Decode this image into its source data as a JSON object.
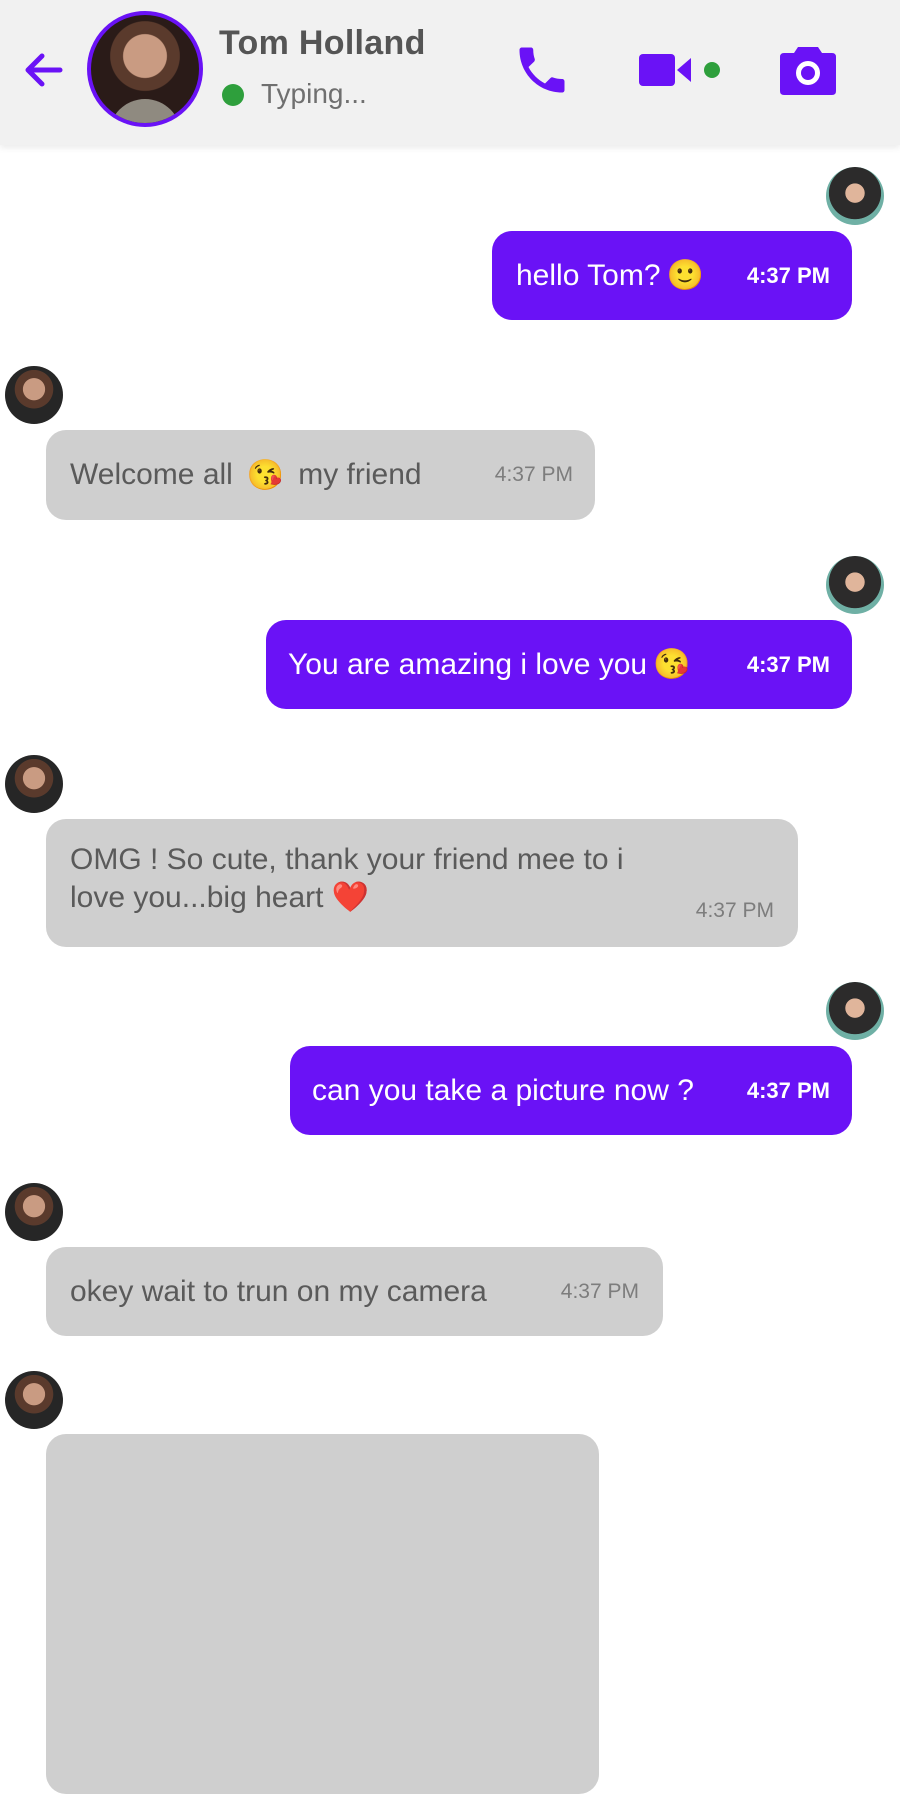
{
  "header": {
    "contact_name": "Tom Holland",
    "status": "Typing...",
    "accent_color": "#6a12f6",
    "status_color": "#2e9f3c",
    "icons": [
      "back-arrow-icon",
      "phone-icon",
      "video-icon",
      "camera-icon"
    ]
  },
  "messages": [
    {
      "sender": "me",
      "text": "hello Tom?",
      "emoji": "🙂",
      "time": "4:37 PM"
    },
    {
      "sender": "Tom Holland",
      "text_before": "Welcome all",
      "emoji": "😘",
      "text_after": "my friend",
      "time": "4:37 PM"
    },
    {
      "sender": "me",
      "text": "You are amazing i love you",
      "emoji": "😘",
      "time": "4:37 PM"
    },
    {
      "sender": "Tom Holland",
      "line1": "OMG ! So cute, thank your friend mee to i",
      "line2": "love you...big heart",
      "emoji": "❤️",
      "time": "4:37 PM"
    },
    {
      "sender": "me",
      "text": "can you take a picture now ?",
      "time": "4:37 PM"
    },
    {
      "sender": "Tom Holland",
      "text": "okey wait to trun on my camera",
      "time": "4:37 PM"
    },
    {
      "sender": "Tom Holland",
      "type": "photo"
    }
  ]
}
